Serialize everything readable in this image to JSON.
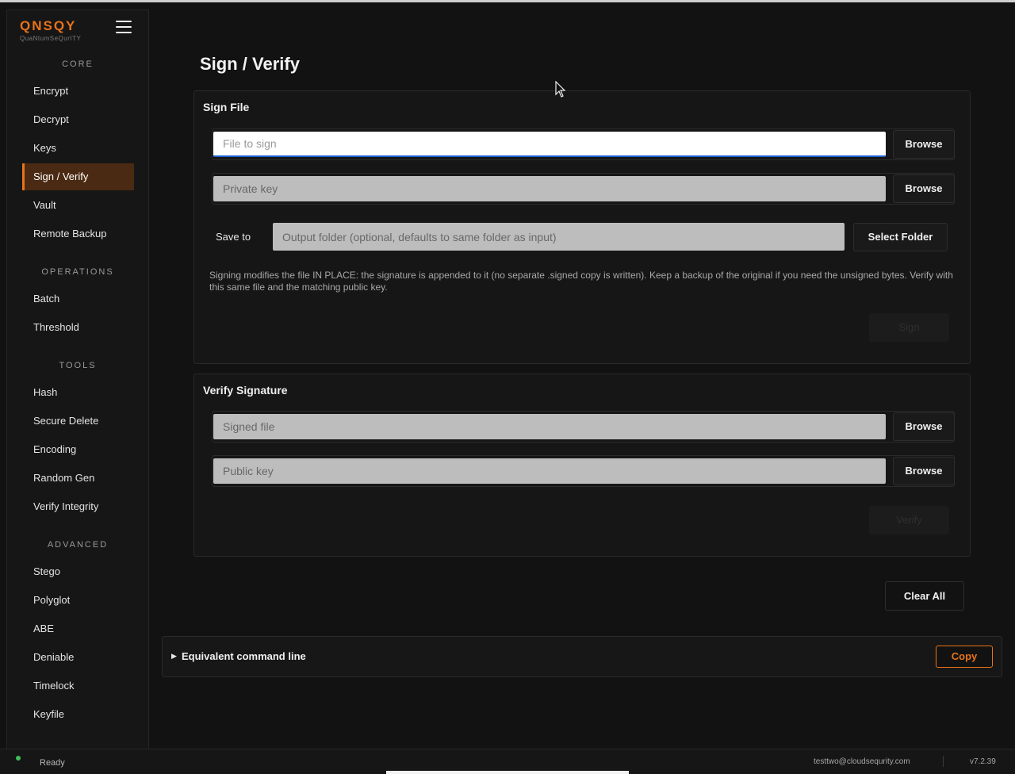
{
  "app": {
    "logo_main": "QNSQY",
    "logo_sub": "QuaNtumSeQurITY"
  },
  "sidebar": {
    "sections": [
      {
        "label": "CORE",
        "items": [
          {
            "label": "Encrypt"
          },
          {
            "label": "Decrypt"
          },
          {
            "label": "Keys"
          },
          {
            "label": "Sign / Verify",
            "active": true
          },
          {
            "label": "Vault"
          },
          {
            "label": "Remote Backup"
          }
        ]
      },
      {
        "label": "OPERATIONS",
        "items": [
          {
            "label": "Batch"
          },
          {
            "label": "Threshold"
          }
        ]
      },
      {
        "label": "TOOLS",
        "items": [
          {
            "label": "Hash"
          },
          {
            "label": "Secure Delete"
          },
          {
            "label": "Encoding"
          },
          {
            "label": "Random Gen"
          },
          {
            "label": "Verify Integrity"
          }
        ]
      },
      {
        "label": "ADVANCED",
        "items": [
          {
            "label": "Stego"
          },
          {
            "label": "Polyglot"
          },
          {
            "label": "ABE"
          },
          {
            "label": "Deniable"
          },
          {
            "label": "Timelock"
          },
          {
            "label": "Keyfile"
          }
        ]
      }
    ]
  },
  "page": {
    "title": "Sign / Verify"
  },
  "sign": {
    "title": "Sign File",
    "file_placeholder": "File to sign",
    "key_placeholder": "Private key",
    "browse_label": "Browse",
    "save_to_label": "Save to",
    "output_placeholder": "Output folder (optional, defaults to same folder as input)",
    "select_folder_label": "Select Folder",
    "info": "Signing modifies the file IN PLACE: the signature is appended to it (no separate .signed copy is written). Keep a backup of the original if you need the unsigned bytes. Verify with this same file and the matching public key.",
    "action_label": "Sign"
  },
  "verify": {
    "title": "Verify Signature",
    "file_placeholder": "Signed file",
    "key_placeholder": "Public key",
    "browse_label": "Browse",
    "action_label": "Verify"
  },
  "clear_all_label": "Clear All",
  "command_line": {
    "label": "Equivalent command line",
    "copy_label": "Copy"
  },
  "status": {
    "text": "Ready",
    "user": "testtwo@cloudsequrity.com",
    "version": "v7.2.39"
  },
  "colors": {
    "accent": "#e8731a",
    "active_nav_bg": "#4a2a12",
    "background": "#121212",
    "status_ok": "#3fbf5a"
  }
}
